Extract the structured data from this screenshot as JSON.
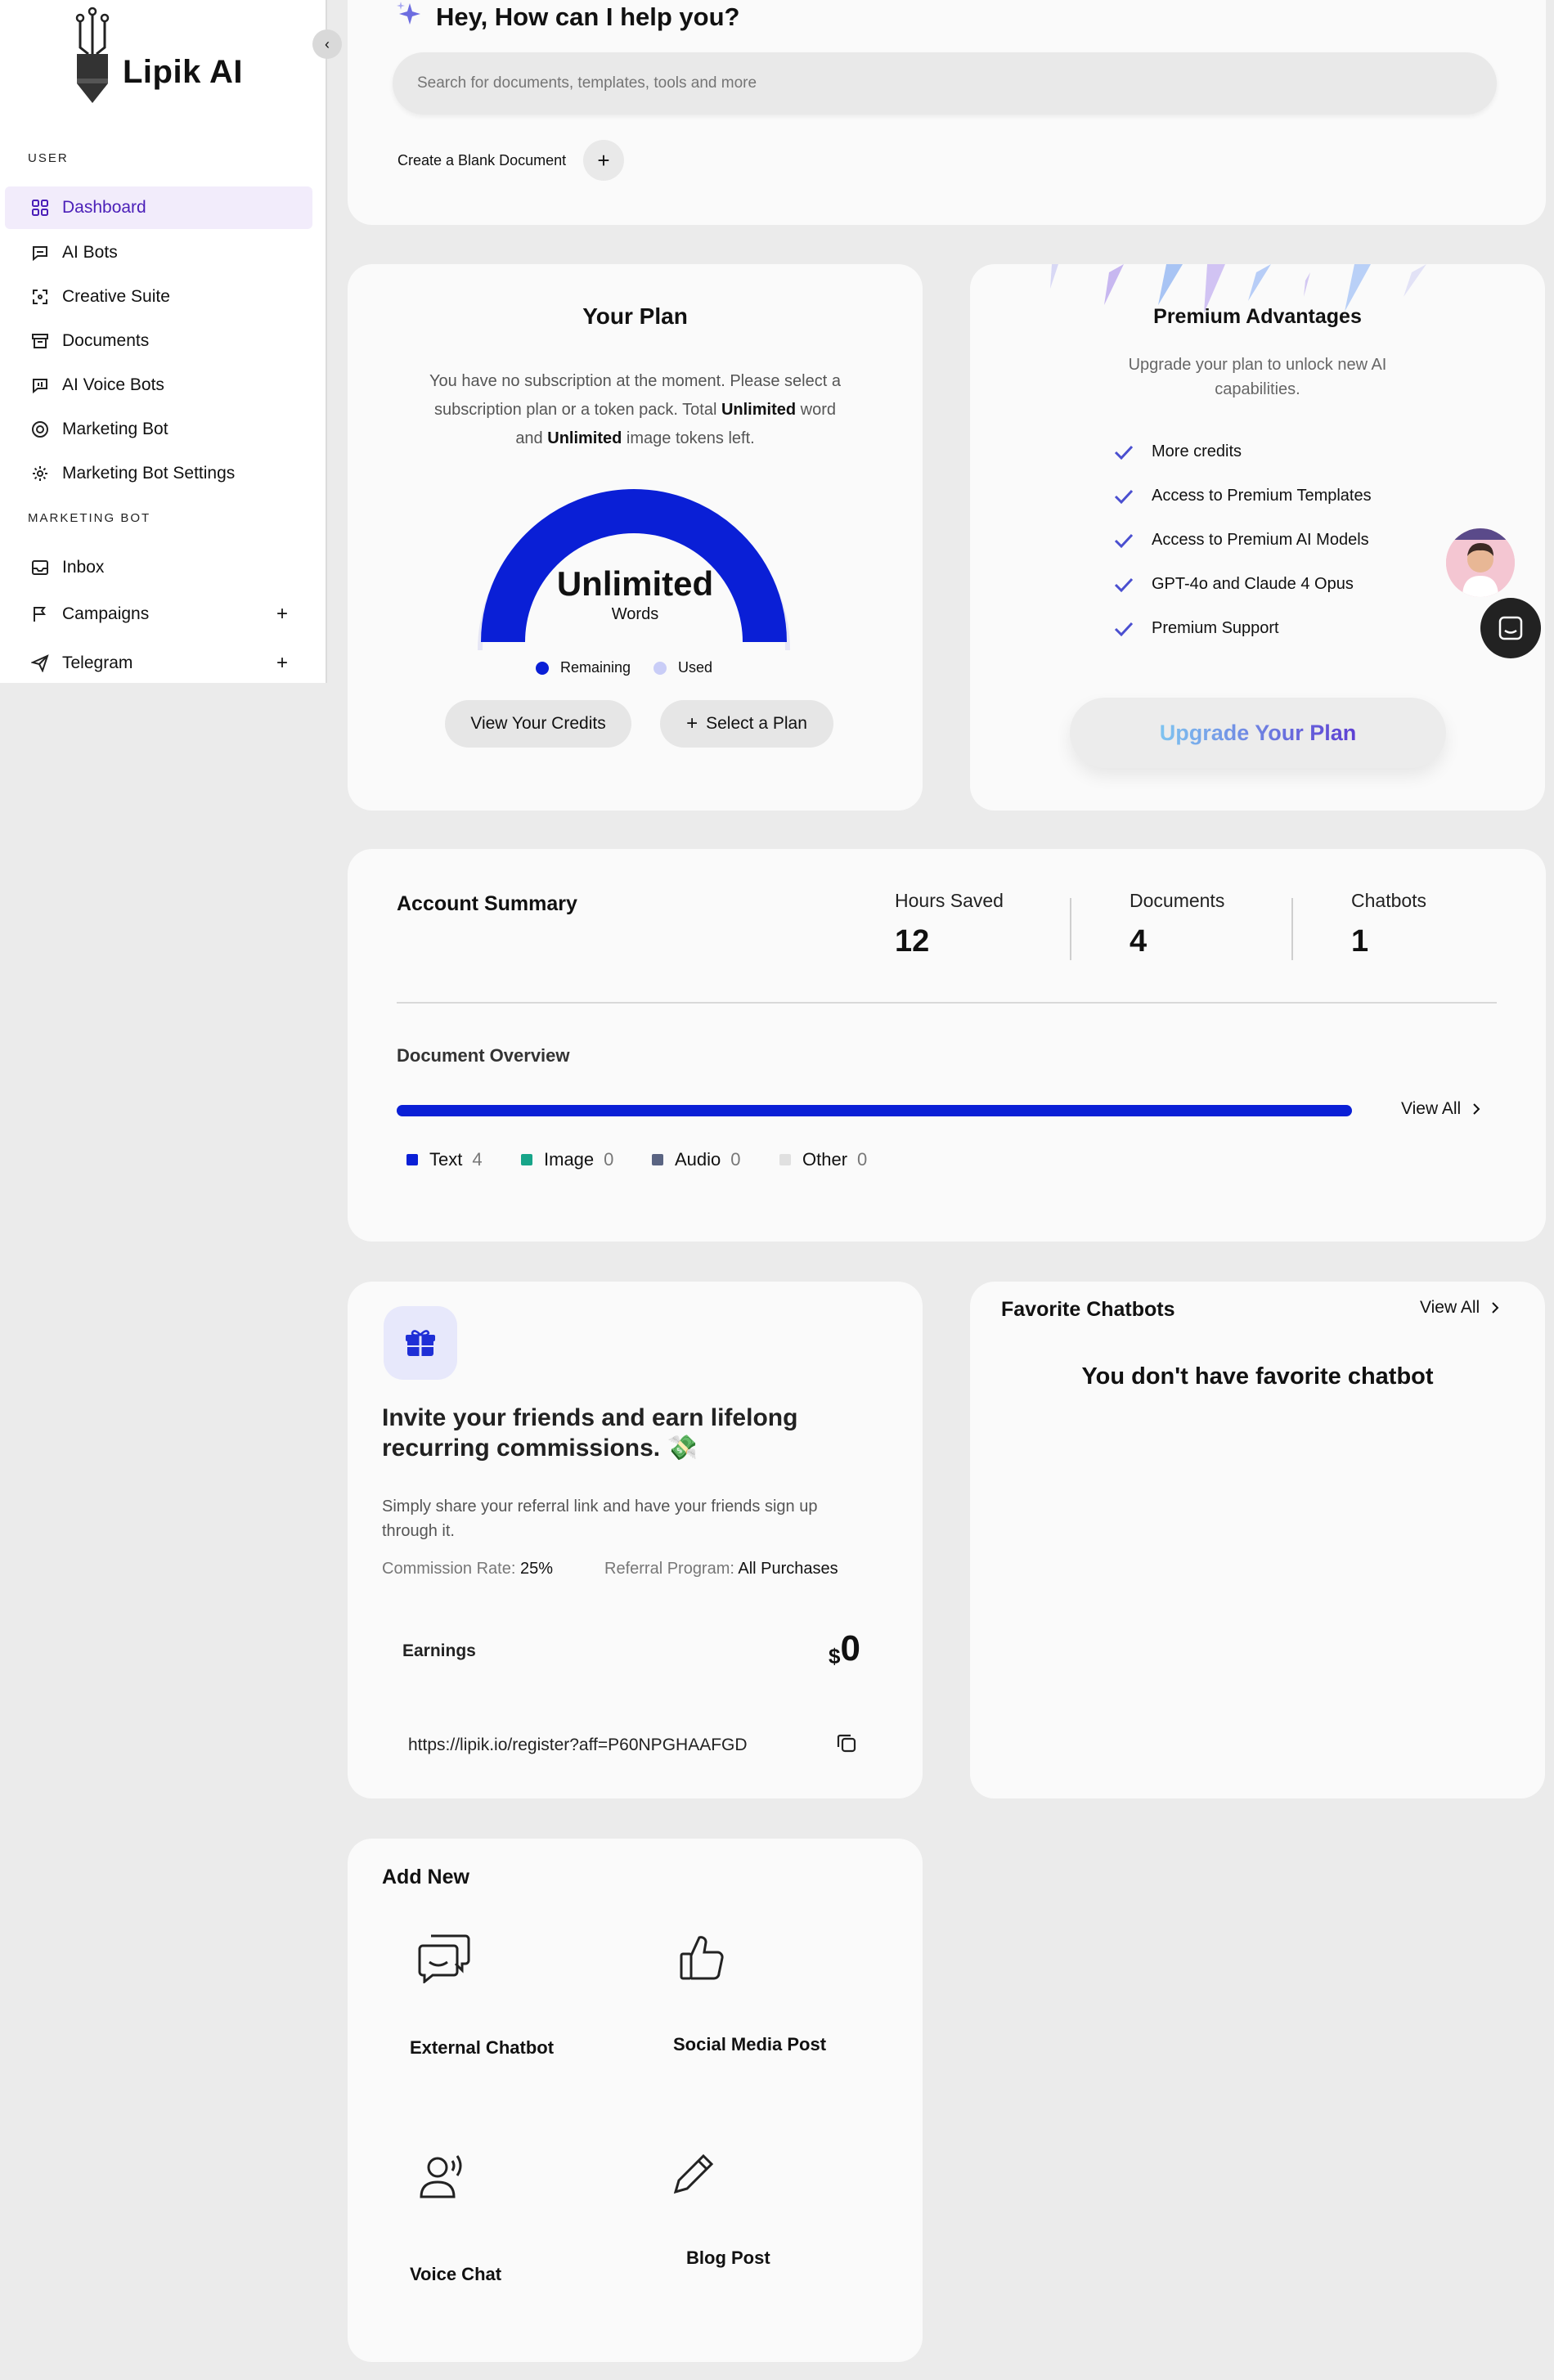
{
  "brand": {
    "name": "Lipik AI"
  },
  "sidebar": {
    "section_user": "USER",
    "section_marketing": "MARKETING BOT",
    "items": [
      {
        "label": "Dashboard"
      },
      {
        "label": "AI Bots"
      },
      {
        "label": "Creative Suite"
      },
      {
        "label": "Documents"
      },
      {
        "label": "AI Voice Bots"
      },
      {
        "label": "Marketing Bot"
      },
      {
        "label": "Marketing Bot Settings"
      }
    ],
    "marketing_items": [
      {
        "label": "Inbox"
      },
      {
        "label": "Campaigns",
        "expand": "+"
      },
      {
        "label": "Telegram",
        "expand": "+"
      }
    ],
    "collapse_glyph": "‹"
  },
  "hero": {
    "greeting": "Hey, How can I help you?",
    "search_placeholder": "Search for documents, templates, tools and more",
    "create_blank": "Create a Blank Document",
    "create_icon": "+"
  },
  "plan": {
    "title": "Your Plan",
    "desc_1": "You have no subscription at the moment. Please select a",
    "desc_2a": "subscription plan or a token pack. Total ",
    "desc_2b": "Unlimited",
    "desc_2c": " word",
    "desc_3a": "and ",
    "desc_3b": "Unlimited",
    "desc_3c": " image tokens left.",
    "gauge_value": "Unlimited",
    "gauge_unit": "Words",
    "gauge_remaining_fraction": 1.0,
    "legend_remaining": "Remaining",
    "legend_used": "Used",
    "btn_credits": "View Your Credits",
    "btn_select": "Select a Plan",
    "btn_select_icon": "+",
    "colors": {
      "remaining": "#0a1fd6",
      "used": "#c9cdf7"
    }
  },
  "premium": {
    "title": "Premium Advantages",
    "subtitle_1": "Upgrade your plan to unlock new AI",
    "subtitle_2": "capabilities.",
    "features": [
      "More credits",
      "Access to Premium Templates",
      "Access to Premium AI Models",
      "GPT-4o and Claude 4 Opus",
      "Premium Support"
    ],
    "upgrade_btn": "Upgrade Your Plan"
  },
  "summary": {
    "title": "Account Summary",
    "stats": [
      {
        "label": "Hours Saved",
        "value": "12"
      },
      {
        "label": "Documents",
        "value": "4"
      },
      {
        "label": "Chatbots",
        "value": "1"
      }
    ],
    "overview_title": "Document Overview",
    "view_all": "View All",
    "legend": [
      {
        "label": "Text",
        "count": "4",
        "color": "#0a1fd6"
      },
      {
        "label": "Image",
        "count": "0",
        "color": "#17a589"
      },
      {
        "label": "Audio",
        "count": "0",
        "color": "#5a6482"
      },
      {
        "label": "Other",
        "count": "0",
        "color": "#e0e0e0"
      }
    ],
    "text_fraction": 1.0
  },
  "referral": {
    "title_1": "Invite your friends and earn lifelong",
    "title_2": "recurring commissions.",
    "title_emoji": "💸",
    "desc_1": "Simply share your referral link and have your friends sign up",
    "desc_2": "through it.",
    "commission_label": "Commission Rate:",
    "commission_value": "25%",
    "program_label": "Referral Program:",
    "program_value": "All Purchases",
    "earnings_label": "Earnings",
    "earnings_currency": "$",
    "earnings_value": "0",
    "link": "https://lipik.io/register?aff=P60NPGHAAFGD"
  },
  "favorites": {
    "title": "Favorite Chatbots",
    "view_all": "View All",
    "empty": "You don't have favorite chatbot"
  },
  "add_new": {
    "title": "Add New",
    "items": [
      {
        "label": "External Chatbot",
        "icon": "chat-bubbles-icon"
      },
      {
        "label": "Social Media Post",
        "icon": "thumbs-up-icon"
      },
      {
        "label": "Voice Chat",
        "icon": "voice-user-icon"
      },
      {
        "label": "Blog Post",
        "icon": "pencil-icon"
      }
    ]
  }
}
